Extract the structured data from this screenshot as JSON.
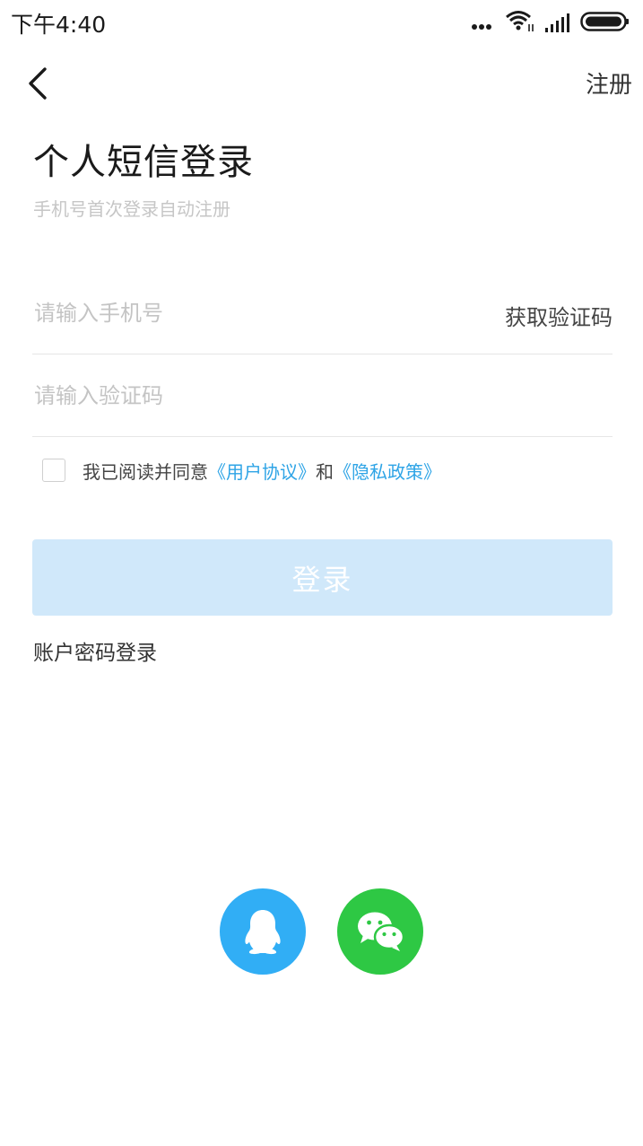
{
  "status_bar": {
    "time": "下午4:40",
    "icons": [
      "more-dots-icon",
      "wifi-icon",
      "signal-icon",
      "battery-icon"
    ]
  },
  "nav": {
    "back_icon": "chevron-left-icon",
    "register_label": "注册"
  },
  "header": {
    "title": "个人短信登录",
    "subtitle": "手机号首次登录自动注册"
  },
  "form": {
    "phone_placeholder": "请输入手机号",
    "phone_value": "",
    "get_code_label": "获取验证码",
    "code_placeholder": "请输入验证码",
    "code_value": "",
    "agreement": {
      "checked": false,
      "prefix": "我已阅读并同意",
      "user_agreement": "《用户协议》",
      "conjunction": "和",
      "privacy_policy": "《隐私政策》"
    },
    "login_label": "登录",
    "password_login_label": "账户密码登录"
  },
  "social": [
    {
      "name": "qq",
      "icon": "qq-icon"
    },
    {
      "name": "wechat",
      "icon": "wechat-icon"
    }
  ],
  "colors": {
    "link": "#2ea4e6",
    "login_button_disabled": "#d0e8fa",
    "qq": "#31aef5",
    "wechat": "#2ec844"
  }
}
